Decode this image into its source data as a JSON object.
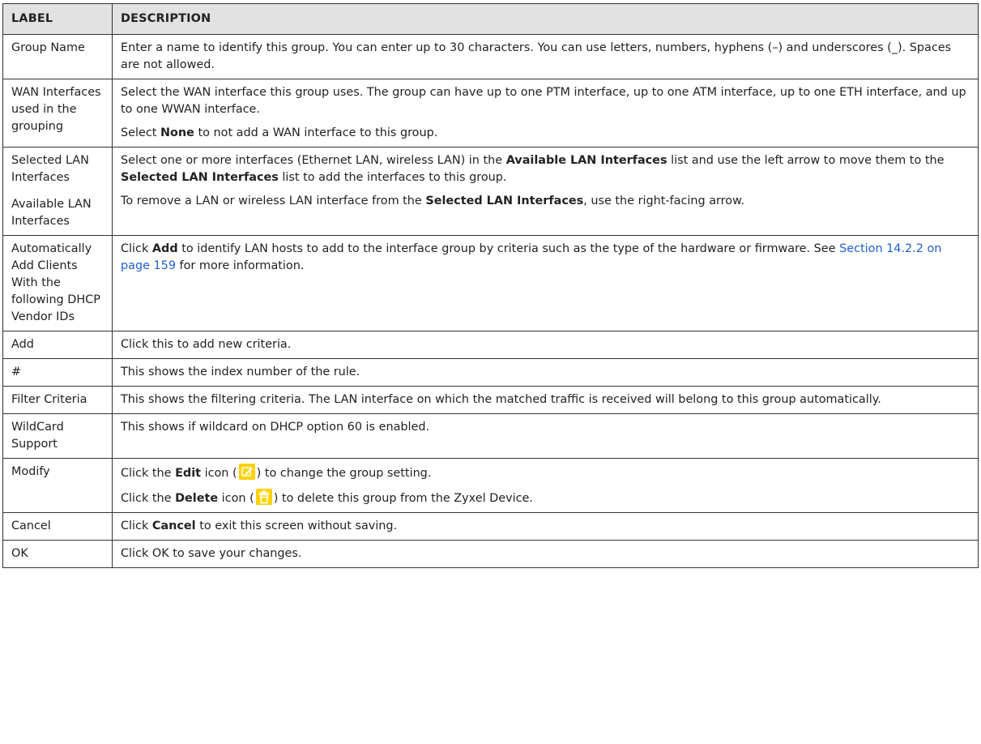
{
  "header": {
    "label": "LABEL",
    "description": "DESCRIPTION"
  },
  "rows": [
    {
      "label": [
        "Group Name"
      ],
      "desc": [
        {
          "t": "Enter a name to identify this group. You can enter up to 30 characters. You can use letters, numbers, hyphens (–) and underscores (_). Spaces are not allowed."
        }
      ]
    },
    {
      "label": [
        "WAN Interfaces used in the grouping"
      ],
      "desc": [
        {
          "t": "Select the WAN interface this group uses. The group can have up to one PTM interface, up to one ATM interface, up to one ETH interface, and up to one WWAN interface."
        },
        {
          "a": "Select ",
          "b": "None",
          "c": " to not add a WAN interface to this group."
        }
      ]
    },
    {
      "label": [
        "Selected LAN Interfaces",
        "Available LAN Interfaces"
      ],
      "desc": [
        {
          "a": "Select one or more interfaces (Ethernet LAN, wireless LAN) in the ",
          "b": "Available LAN Interfaces",
          "c": " list and use the left arrow to move them to the ",
          "d": "Selected LAN Interfaces",
          "e": " list to add the interfaces to this group."
        },
        {
          "a": "To remove a LAN or wireless LAN interface from the ",
          "b": "Selected LAN Interfaces",
          "c": ", use the right-facing arrow."
        }
      ]
    },
    {
      "label": [
        "Automatically Add Clients With the following DHCP Vendor IDs"
      ],
      "desc": [
        {
          "a": "Click ",
          "b": "Add",
          "c": " to identify LAN hosts to add to the interface group by criteria such as the type of the hardware or firmware. See ",
          "link": "Section 14.2.2 on page 159",
          "d": " for more information."
        }
      ]
    },
    {
      "label": [
        "Add"
      ],
      "desc": [
        {
          "t": "Click this to add new criteria."
        }
      ]
    },
    {
      "label": [
        "#"
      ],
      "desc": [
        {
          "t": "This shows the index number of the rule."
        }
      ]
    },
    {
      "label": [
        "Filter Criteria"
      ],
      "desc": [
        {
          "t": "This shows the filtering criteria. The LAN interface on which the matched traffic is received will belong to this group automatically."
        }
      ]
    },
    {
      "label": [
        "WildCard Support"
      ],
      "desc": [
        {
          "t": "This shows if wildcard on DHCP option 60 is enabled."
        }
      ]
    },
    {
      "label": [
        "Modify"
      ],
      "desc": [
        {
          "a": "Click the ",
          "b": "Edit",
          "c": " icon (",
          "icon": "edit-icon",
          "d": ") to change the group setting."
        },
        {
          "a": "Click the ",
          "b": "Delete",
          "c": " icon (",
          "icon": "delete-icon",
          "d": ") to delete this group from the Zyxel Device."
        }
      ]
    },
    {
      "label": [
        "Cancel"
      ],
      "desc": [
        {
          "a": "Click ",
          "b": "Cancel",
          "c": " to exit this screen without saving."
        }
      ]
    },
    {
      "label": [
        "OK"
      ],
      "desc": [
        {
          "t": "Click OK to save your changes."
        }
      ]
    }
  ],
  "colors": {
    "header_bg": "#e2e2e2",
    "icon_bg": "#ffd200",
    "link": "#1f5fd1"
  }
}
